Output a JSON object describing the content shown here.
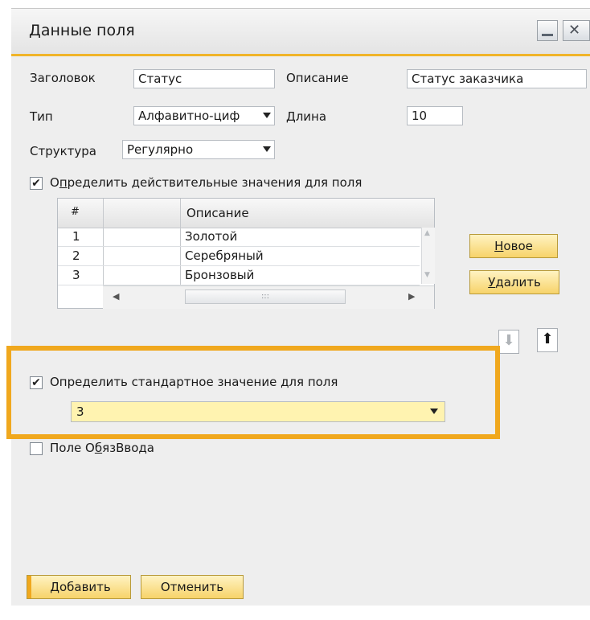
{
  "dialog": {
    "title": "Данные поля"
  },
  "form": {
    "title_label": "Заголовок",
    "title_value": "Статус",
    "description_label": "Описание",
    "description_value": "Статус заказчика",
    "type_label": "Тип",
    "type_value": "Алфавитно-циф",
    "length_label": "Длина",
    "length_value": "10",
    "structure_label": "Структура",
    "structure_value": "Регулярно"
  },
  "valid_values": {
    "checkbox_label_pre": "О",
    "checkbox_label_ul": "п",
    "checkbox_label_post": "ределить действительные значения для поля",
    "checked": true,
    "columns": [
      "#",
      "",
      "Описание"
    ],
    "rows": [
      {
        "num": "1",
        "code": "",
        "desc": "Золотой"
      },
      {
        "num": "2",
        "code": "",
        "desc": "Серебряный"
      },
      {
        "num": "3",
        "code": "",
        "desc": "Бронзовый"
      }
    ],
    "new_button_ul": "Н",
    "new_button_rest": "овое",
    "delete_button_ul": "У",
    "delete_button_rest": "далить",
    "scroll_thumb": ":::"
  },
  "default_value": {
    "checkbox_label_pre": "Опре",
    "checkbox_label_ul": "д",
    "checkbox_label_post": "елить стандартное значение для поля",
    "checked": true,
    "selected": "3"
  },
  "mandatory": {
    "label_pre": "Поле О",
    "label_ul": "б",
    "label_post": "язВвода",
    "checked": false
  },
  "footer": {
    "add_button": "Добавить",
    "cancel_button": "Отменить"
  },
  "colors": {
    "accent": "#f0a81e",
    "button_yellow": "#f7d36a",
    "highlight_field": "#fff3b0"
  },
  "icons": {
    "minimize": "minimize-icon",
    "close": "close-icon",
    "checkmark": "✔",
    "down_arrow": "⬇",
    "up_arrow": "⬆",
    "scroll_left": "◀",
    "scroll_right": "▶",
    "scroll_up": "▲",
    "scroll_down": "▼"
  }
}
